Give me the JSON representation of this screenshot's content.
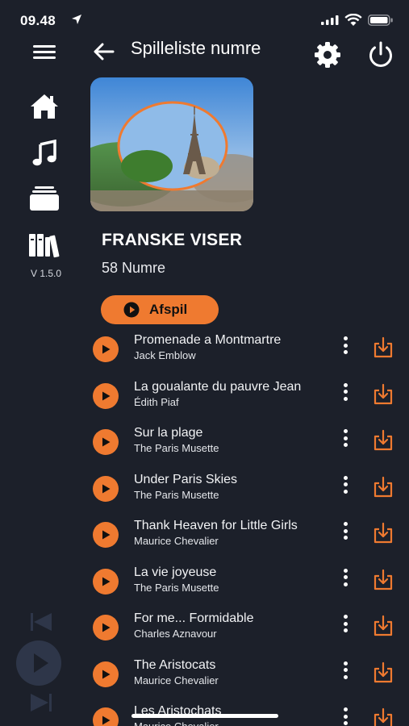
{
  "status_bar": {
    "time": "09.48"
  },
  "header": {
    "title": "Spilleliste numre"
  },
  "sidebar": {
    "version": "V 1.5.0"
  },
  "playlist": {
    "title": "FRANSKE VISER",
    "count": "58 Numre",
    "play_label": "Afspil"
  },
  "tracks": [
    {
      "title": "Promenade a Montmartre",
      "artist": "Jack Emblow"
    },
    {
      "title": "La goualante du pauvre Jean",
      "artist": "Édith Piaf"
    },
    {
      "title": "Sur la plage",
      "artist": "The Paris Musette"
    },
    {
      "title": "Under Paris Skies",
      "artist": "The Paris Musette"
    },
    {
      "title": "Thank Heaven for Little Girls",
      "artist": "Maurice Chevalier"
    },
    {
      "title": "La vie joyeuse",
      "artist": "The Paris Musette"
    },
    {
      "title": "For me... Formidable",
      "artist": "Charles Aznavour"
    },
    {
      "title": "The Aristocats",
      "artist": "Maurice Chevalier"
    },
    {
      "title": "Les Aristochats",
      "artist": "Maurice Chevalier"
    }
  ],
  "colors": {
    "background": "#1c202a",
    "accent": "#ef7a30"
  }
}
